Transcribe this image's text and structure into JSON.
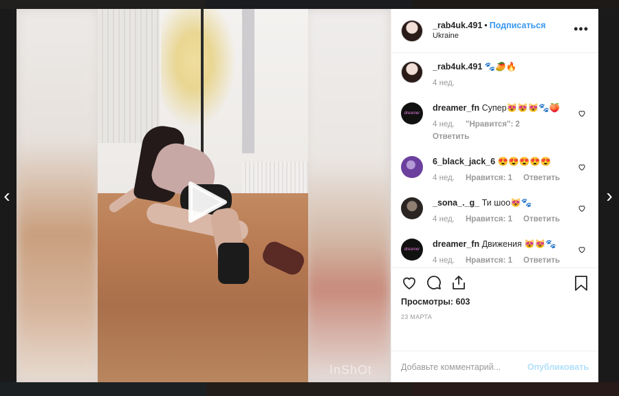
{
  "post": {
    "author": "_rab4uk.491",
    "follow_label": "Подписаться",
    "location": "Ukraine",
    "more_label": "•••",
    "watermark": "InShOt"
  },
  "comments": [
    {
      "user": "_rab4uk.491",
      "text": "🐾🥭🔥",
      "time": "4 нед.",
      "likes": "",
      "reply": "",
      "avatar": "author"
    },
    {
      "user": "dreamer_fn",
      "text": "Супер😻😻😻🐾🍑",
      "time": "4 нед.",
      "likes": "\"Нравится\": 2",
      "reply": "Ответить",
      "avatar": "dark"
    },
    {
      "user": "6_black_jack_6",
      "text": "😍😍😍😍😍",
      "time": "4 нед.",
      "likes": "Нравится: 1",
      "reply": "Ответить",
      "avatar": "purple"
    },
    {
      "user": "_sona_._g_",
      "text": "Ти шоо😻🐾",
      "time": "4 нед.",
      "likes": "Нравится: 1",
      "reply": "Ответить",
      "avatar": "face"
    },
    {
      "user": "dreamer_fn",
      "text": "Движения 😻😻🐾",
      "time": "4 нед.",
      "likes": "Нравится: 1",
      "reply": "Ответить",
      "avatar": "dark"
    }
  ],
  "avatar_dark_text": "dreamer",
  "stats": {
    "views_label": "Просмотры: 603",
    "date": "23 марта"
  },
  "comment_box": {
    "placeholder": "Добавьте комментарий...",
    "publish_label": "Опубликовать"
  },
  "nav": {
    "prev": "‹",
    "next": "›"
  },
  "colors": {
    "accent": "#3897f0",
    "publish_disabled": "#b2dffc",
    "text": "#262626",
    "muted": "#999999"
  }
}
